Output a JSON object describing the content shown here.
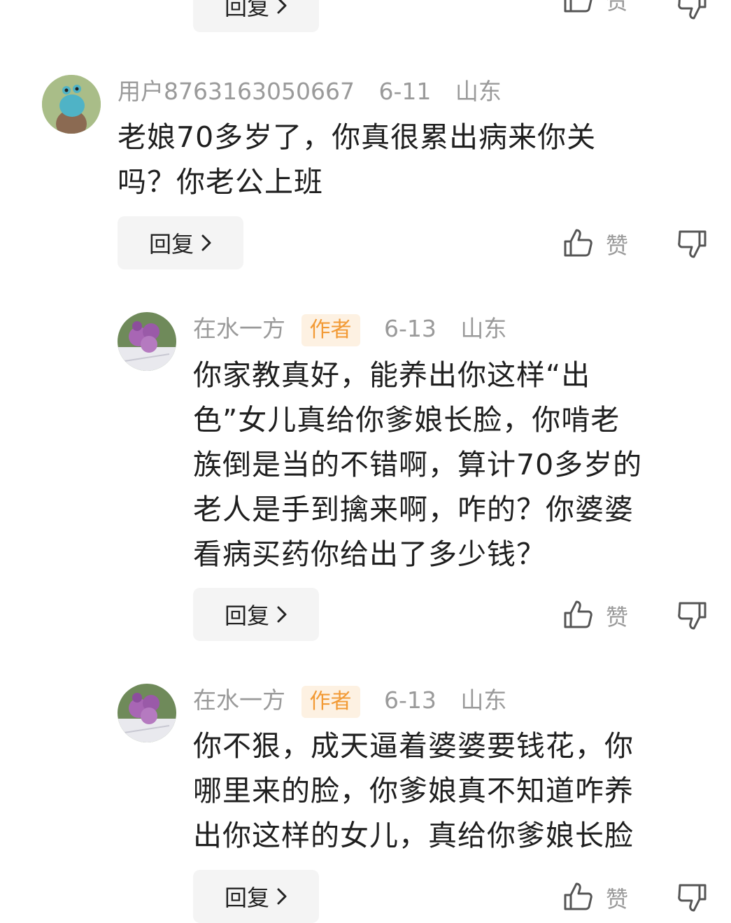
{
  "reply_label": "回复",
  "like_label": "赞",
  "comments": [
    {
      "username": "用户8763163050667",
      "date": "6-11",
      "location": "山东",
      "text_lines": [
        "老娘70多岁了，你真很累出病来你关",
        "吗？你老公上班"
      ]
    },
    {
      "username": "在水一方",
      "badge": "作者",
      "date": "6-13",
      "location": "山东",
      "text_lines": [
        "你家教真好，能养出你这样“出",
        "色”女儿真给你爹娘长脸，你啃老",
        "族倒是当的不错啊，算计70多岁的",
        "老人是手到擒来啊，咋的？你婆婆",
        "看病买药你给出了多少钱？"
      ]
    },
    {
      "username": "在水一方",
      "badge": "作者",
      "date": "6-13",
      "location": "山东",
      "text_lines": [
        "你不狠，成天逼着婆婆要钱花，你",
        "哪里来的脸，你爹娘真不知道咋养",
        "出你这样的女儿，真给你爹娘长脸"
      ]
    }
  ],
  "icons": {
    "like": "thumbs-up-icon",
    "dislike": "thumbs-down-icon",
    "chevron": "chevron-right-icon"
  },
  "colors": {
    "meta_gray": "#9a9a9a",
    "badge_text": "#f29a35",
    "badge_bg": "#fdf1e2",
    "button_bg": "#f4f4f4"
  }
}
